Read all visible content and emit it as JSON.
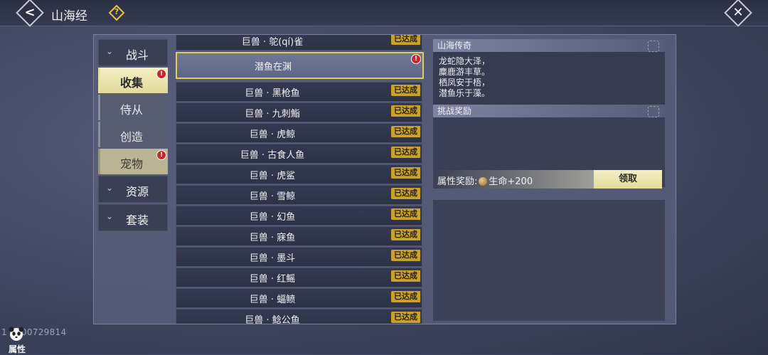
{
  "header": {
    "title": "山海经",
    "back_icon": "chevron-left-icon",
    "help_icon": "question-icon",
    "close_icon": "close-icon"
  },
  "sidebar": {
    "categories": [
      {
        "label": "战斗",
        "arrow": "chevron-down-icon"
      },
      {
        "label": "资源",
        "arrow": "chevron-down-icon"
      },
      {
        "label": "套装",
        "arrow": "chevron-down-icon"
      }
    ],
    "sub_items": [
      {
        "label": "收集",
        "badge": "!"
      },
      {
        "label": "侍从"
      },
      {
        "label": "创造"
      },
      {
        "label": "宠物",
        "badge": "!"
      }
    ]
  },
  "list": {
    "status_label": "已达成",
    "items": [
      {
        "name": "巨兽 · 鸵(qí)雀"
      },
      {
        "name": "潜鱼在渊",
        "selected": true,
        "badge": "!"
      },
      {
        "name": "巨兽 · 黑枪鱼"
      },
      {
        "name": "巨兽 · 九刺鮨"
      },
      {
        "name": "巨兽 · 虎鲸"
      },
      {
        "name": "巨兽 · 古食人鱼"
      },
      {
        "name": "巨兽 · 虎鲨"
      },
      {
        "name": "巨兽 · 雪鲸"
      },
      {
        "name": "巨兽 · 幻鱼"
      },
      {
        "name": "巨兽 · 寐鱼"
      },
      {
        "name": "巨兽 · 墨斗"
      },
      {
        "name": "巨兽 · 红鳐"
      },
      {
        "name": "巨兽 · 蝠鲼"
      },
      {
        "name": "巨兽 · 鲶公鱼"
      }
    ]
  },
  "detail": {
    "legend_title": "山海传奇",
    "poem": [
      "龙蛇隐大泽，",
      "麋鹿游丰草。",
      "栖凤安于梧，",
      "潜鱼乐于藻。"
    ],
    "reward_title": "挑战奖励",
    "reward_label": "属性奖励:",
    "reward_value": "生命+200",
    "claim_label": "领取"
  },
  "footer": {
    "uid": "1    0900729814",
    "attr_label": "属性"
  },
  "colors": {
    "accent_gold": "#e6cc54",
    "status_tag": "#c9a22c",
    "badge_red": "#c8282c"
  }
}
